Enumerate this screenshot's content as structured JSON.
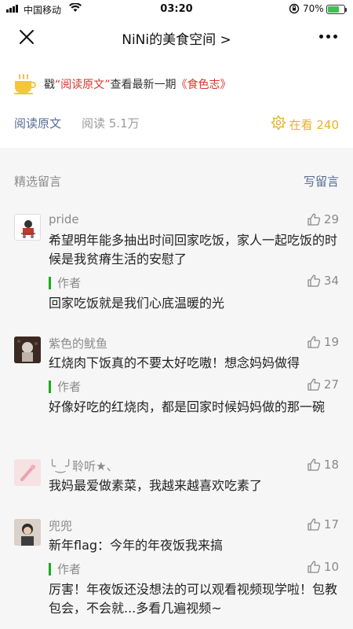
{
  "status_bar": {
    "carrier": "中国移动",
    "time": "03:20",
    "battery": "70%"
  },
  "nav": {
    "title": "NiNi的美食空间 >"
  },
  "promo": {
    "prefix": "戳",
    "link": "“阅读原文”",
    "middle": "查看最新一期",
    "magazine": "《食色志》"
  },
  "read_row": {
    "original_label": "阅读原文",
    "reads": "阅读 5.1万",
    "watching": "在看 240"
  },
  "comments_section": {
    "title": "精选留言",
    "write_label": "写留言",
    "comments": [
      {
        "nickname": "pride",
        "likes": "29",
        "text": "希望明年能多抽出时间回家吃饭，家人一起吃饭的时候是我贫瘠生活的安慰了",
        "author_label": "作者",
        "author_likes": "34",
        "reply": "回家吃饭就是我们心底温暖的光"
      },
      {
        "nickname": "紫色的鱿鱼",
        "likes": "19",
        "text": "红烧肉下饭真的不要太好吃嗷！想念妈妈做得",
        "author_label": "作者",
        "author_likes": "27",
        "reply": "好像好吃的红烧肉，都是回家时候妈妈做的那一碗"
      },
      {
        "nickname": "╰‿╯聆听★、",
        "likes": "18",
        "text": "我妈最爱做素菜，我越来越喜欢吃素了"
      },
      {
        "nickname": "兜兜",
        "likes": "17",
        "text": "新年flag：今年的年夜饭我来搞",
        "author_label": "作者",
        "author_likes": "10",
        "reply": "厉害！年夜饭还没想法的可以观看视频现学啦！包教包会，不会就...多看几遍视频~"
      }
    ]
  },
  "colors": {
    "link_blue": "#576b95",
    "accent_gold": "#e8b12b",
    "author_green": "#1aad19",
    "promo_red": "#d9342b"
  }
}
